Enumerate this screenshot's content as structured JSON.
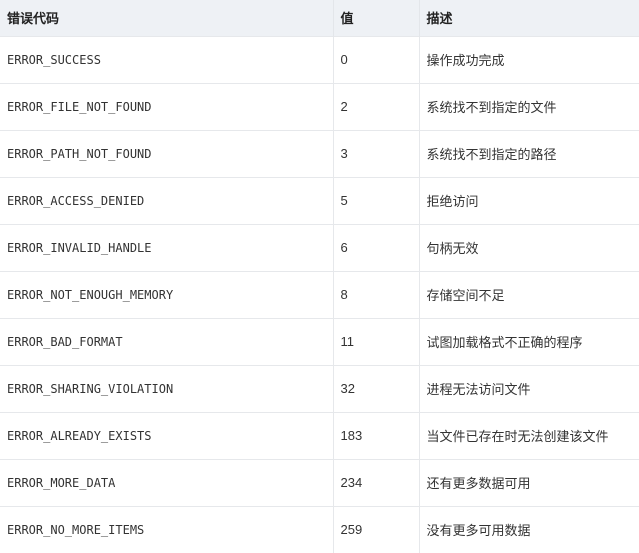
{
  "table": {
    "headers": {
      "code": "错误代码",
      "value": "值",
      "description": "描述"
    },
    "rows": [
      {
        "code": "ERROR_SUCCESS",
        "value": "0",
        "description": "操作成功完成"
      },
      {
        "code": "ERROR_FILE_NOT_FOUND",
        "value": "2",
        "description": "系统找不到指定的文件"
      },
      {
        "code": "ERROR_PATH_NOT_FOUND",
        "value": "3",
        "description": "系统找不到指定的路径"
      },
      {
        "code": "ERROR_ACCESS_DENIED",
        "value": "5",
        "description": "拒绝访问"
      },
      {
        "code": "ERROR_INVALID_HANDLE",
        "value": "6",
        "description": "句柄无效"
      },
      {
        "code": "ERROR_NOT_ENOUGH_MEMORY",
        "value": "8",
        "description": "存储空间不足"
      },
      {
        "code": "ERROR_BAD_FORMAT",
        "value": "11",
        "description": "试图加载格式不正确的程序"
      },
      {
        "code": "ERROR_SHARING_VIOLATION",
        "value": "32",
        "description": "进程无法访问文件"
      },
      {
        "code": "ERROR_ALREADY_EXISTS",
        "value": "183",
        "description": "当文件已存在时无法创建该文件"
      },
      {
        "code": "ERROR_MORE_DATA",
        "value": "234",
        "description": "还有更多数据可用"
      },
      {
        "code": "ERROR_NO_MORE_ITEMS",
        "value": "259",
        "description": "没有更多可用数据"
      }
    ]
  }
}
